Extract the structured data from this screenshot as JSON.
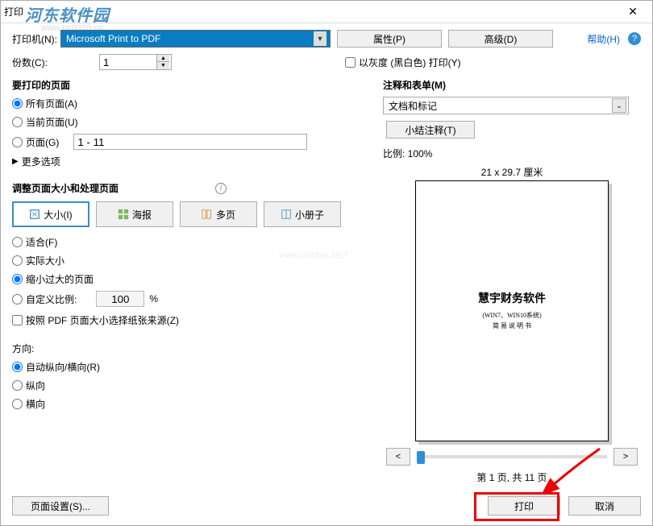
{
  "title": "打印",
  "watermark_logo": "河东软件园",
  "watermark_url": "www.pc0359.cn",
  "watermark_center": "www.pHome.NET",
  "printer": {
    "label": "打印机(N):",
    "selected": "Microsoft Print to PDF"
  },
  "properties_btn": "属性(P)",
  "advanced_btn": "高级(D)",
  "help_link": "帮助(H)",
  "copies": {
    "label": "份数(C):",
    "value": "1"
  },
  "grayscale_label": "以灰度 (黑白色) 打印(Y)",
  "pages_section": {
    "title": "要打印的页面",
    "all": "所有页面(A)",
    "current": "当前页面(U)",
    "pages": "页面(G)",
    "range_value": "1 - 11",
    "more": "更多选项"
  },
  "size_section": {
    "title": "调整页面大小和处理页面",
    "tabs": {
      "size": "大小(I)",
      "poster": "海报",
      "multi": "多页",
      "booklet": "小册子"
    },
    "fit": "适合(F)",
    "actual": "实际大小",
    "shrink": "缩小过大的页面",
    "custom": "自定义比例:",
    "custom_value": "100",
    "percent": "%",
    "pdf_paper": "按照 PDF 页面大小选择纸张来源(Z)"
  },
  "orientation": {
    "title": "方向:",
    "auto": "自动纵向/横向(R)",
    "portrait": "纵向",
    "landscape": "横向"
  },
  "comments": {
    "title": "注释和表单(M)",
    "selected": "文档和标记",
    "summarize": "小结注释(T)"
  },
  "scale": "比例: 100%",
  "preview": {
    "dimensions": "21 x 29.7 厘米",
    "doc_title": "慧宇财务软件",
    "doc_sub1": "(WIN7、WIN10系统)",
    "doc_sub2": "简 易 说 明 书",
    "page_info": "第 1 页, 共 11 页"
  },
  "page_setup_btn": "页面设置(S)...",
  "print_btn": "打印",
  "cancel_btn": "取消"
}
